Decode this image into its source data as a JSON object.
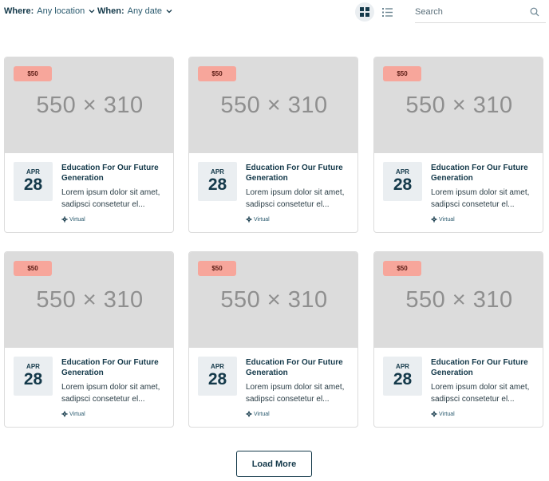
{
  "filters": {
    "where_label": "Where:",
    "where_value": "Any location",
    "when_label": "When:",
    "when_value": "Any date"
  },
  "search": {
    "placeholder": "Search"
  },
  "view_toggle": {
    "active": "grid",
    "icons": [
      "grid-view-icon",
      "list-view-icon"
    ]
  },
  "colors": {
    "accent": "#14394a",
    "price_badge": "#f7a69b",
    "date_bg": "#eaeef1",
    "thumb_bg": "#dcdcdc"
  },
  "events": [
    {
      "image_placeholder": "550 × 310",
      "price": "$50",
      "month": "APR",
      "day": "28",
      "title": "Education For Our Future Generation",
      "excerpt": "Lorem ipsum dolor sit amet, sadipsci consetetur el...",
      "location": "Virtual"
    },
    {
      "image_placeholder": "550 × 310",
      "price": "$50",
      "month": "APR",
      "day": "28",
      "title": "Education For Our Future Generation",
      "excerpt": "Lorem ipsum dolor sit amet, sadipsci consetetur el...",
      "location": "Virtual"
    },
    {
      "image_placeholder": "550 × 310",
      "price": "$50",
      "month": "APR",
      "day": "28",
      "title": "Education For Our Future Generation",
      "excerpt": "Lorem ipsum dolor sit amet, sadipsci consetetur el...",
      "location": "Virtual"
    },
    {
      "image_placeholder": "550 × 310",
      "price": "$50",
      "month": "APR",
      "day": "28",
      "title": "Education For Our Future Generation",
      "excerpt": "Lorem ipsum dolor sit amet, sadipsci consetetur el...",
      "location": "Virtual"
    },
    {
      "image_placeholder": "550 × 310",
      "price": "$50",
      "month": "APR",
      "day": "28",
      "title": "Education For Our Future Generation",
      "excerpt": "Lorem ipsum dolor sit amet, sadipsci consetetur el...",
      "location": "Virtual"
    },
    {
      "image_placeholder": "550 × 310",
      "price": "$50",
      "month": "APR",
      "day": "28",
      "title": "Education For Our Future Generation",
      "excerpt": "Lorem ipsum dolor sit amet, sadipsci consetetur el...",
      "location": "Virtual"
    }
  ],
  "load_more_label": "Load More"
}
